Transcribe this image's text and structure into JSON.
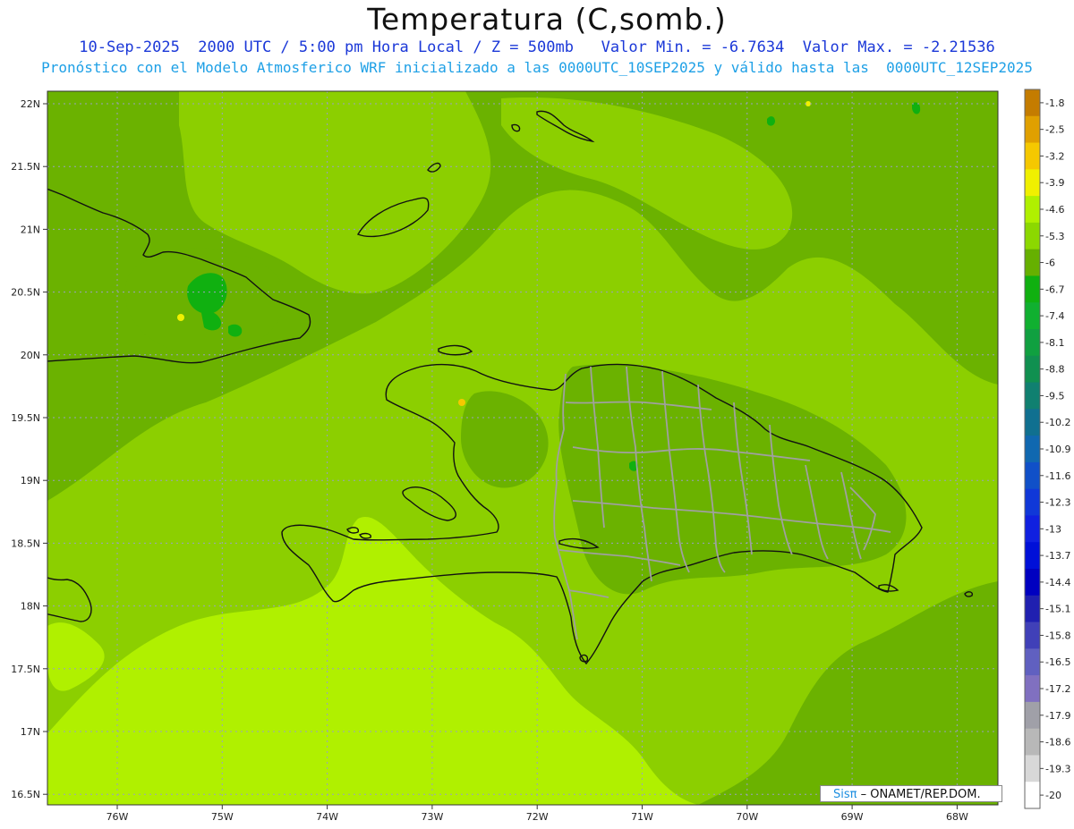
{
  "header": {
    "title": "Temperatura (C,somb.)",
    "line1": "10-Sep-2025  2000 UTC / 5:00 pm Hora Local / Z = 500mb   Valor Min. = -6.7634  Valor Max. = -2.21536",
    "line2": "Pronóstico con el Modelo Atmosferico WRF inicializado a las 0000UTC_10SEP2025 y válido hasta las  0000UTC_12SEP2025"
  },
  "map": {
    "lat_labels": [
      "22N",
      "21.5N",
      "21N",
      "20.5N",
      "20N",
      "19.5N",
      "19N",
      "18.5N",
      "18N",
      "17.5N",
      "17N",
      "16.5N"
    ],
    "lon_labels": [
      "76W",
      "75W",
      "74W",
      "73W",
      "72W",
      "71W",
      "70W",
      "69W",
      "68W"
    ]
  },
  "colorbar": {
    "labels": [
      "-1.8",
      "-2.5",
      "-3.2",
      "-3.9",
      "-4.6",
      "-5.3",
      "-6",
      "-6.7",
      "-7.4",
      "-8.1",
      "-8.8",
      "-9.5",
      "-10.2",
      "-10.9",
      "-11.6",
      "-12.3",
      "-13",
      "-13.7",
      "-14.4",
      "-15.1",
      "-15.8",
      "-16.5",
      "-17.2",
      "-17.9",
      "-18.6",
      "-19.3",
      "-20"
    ],
    "colors": [
      "#c47c00",
      "#e0a000",
      "#f5c800",
      "#f0f000",
      "#b0f000",
      "#8cd800",
      "#66b000",
      "#10b010",
      "#10b030",
      "#10a040",
      "#109050",
      "#108070",
      "#107090",
      "#1068b0",
      "#1050c8",
      "#1038d8",
      "#1020e0",
      "#0010d8",
      "#0000c0",
      "#2020b0",
      "#4040b8",
      "#6060c0",
      "#8070c0",
      "#a0a0a8",
      "#b8b8b8",
      "#d8d8d8",
      "#ffffff"
    ]
  },
  "credit": {
    "brand": "Sisπ",
    "text": " – ONAMET/REP.DOM."
  }
}
